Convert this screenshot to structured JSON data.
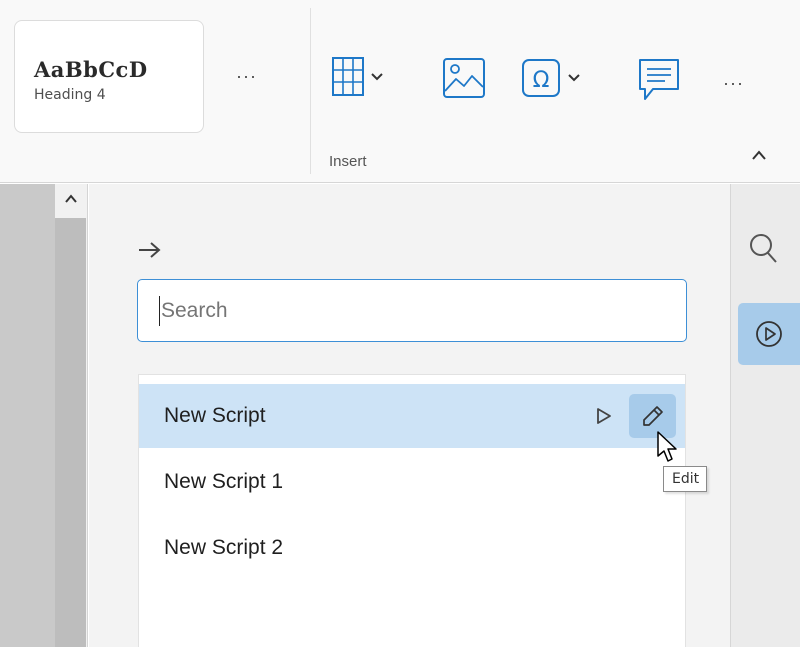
{
  "ribbon": {
    "style_gallery": {
      "sample_text": "AaBbCcD",
      "style_name": "Heading 4"
    },
    "style_more": "···",
    "insert_group": {
      "label": "Insert",
      "buttons": [
        {
          "icon": "table-icon",
          "has_dropdown": true
        },
        {
          "icon": "image-icon",
          "has_dropdown": false
        },
        {
          "icon": "omega-symbol-icon",
          "has_dropdown": true
        },
        {
          "icon": "comment-icon",
          "has_dropdown": false
        }
      ],
      "more": "···"
    },
    "collapse_icon": "chevron-up-icon"
  },
  "ruler": {
    "scroll_icon": "chevron-up-icon"
  },
  "scripts_panel": {
    "back_icon": "arrow-right-icon",
    "search": {
      "placeholder": "Search",
      "value": ""
    },
    "items": [
      {
        "label": "New Script",
        "selected": true
      },
      {
        "label": "New Script 1",
        "selected": false
      },
      {
        "label": "New Script 2",
        "selected": false
      }
    ],
    "tooltip": "Edit"
  },
  "rail": {
    "search_icon": "search-icon",
    "scripts_icon": "play-circle-icon",
    "active_color": "#a7cbea"
  },
  "colors": {
    "accent": "#3d8fd6",
    "selected_row": "#cde3f6",
    "icon_blue": "#1e78c8"
  }
}
